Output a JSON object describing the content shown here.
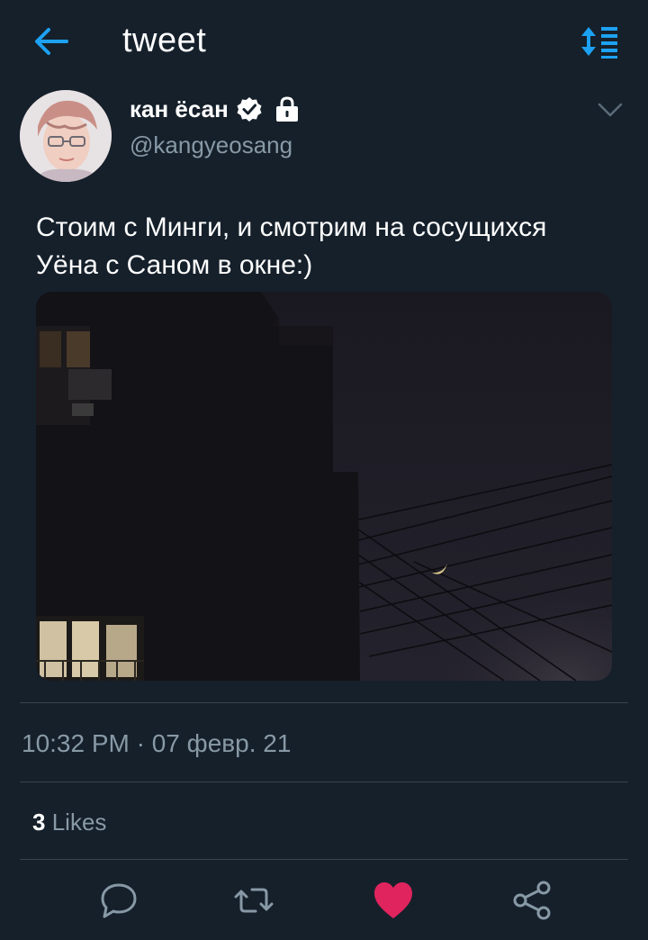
{
  "header": {
    "title": "tweet",
    "back_icon": "arrow-left-icon",
    "sort_icon": "sort-icon",
    "accent_color": "#1da1f2"
  },
  "tweet": {
    "author": {
      "display_name": "кан ёсан",
      "handle": "@kangyeosang",
      "verified": true,
      "protected": true
    },
    "text_line1": "Стоим с Минги, и смотрим на сосущихся",
    "text_line2": "Уёна с Саном в окне:)",
    "timestamp": "10:32 PM · 07 февр. 21",
    "likes": {
      "count": "3",
      "label": "Likes"
    },
    "liked": true,
    "like_color": "#e0245e"
  },
  "actions": [
    "reply-icon",
    "retweet-icon",
    "like-icon",
    "share-icon"
  ]
}
